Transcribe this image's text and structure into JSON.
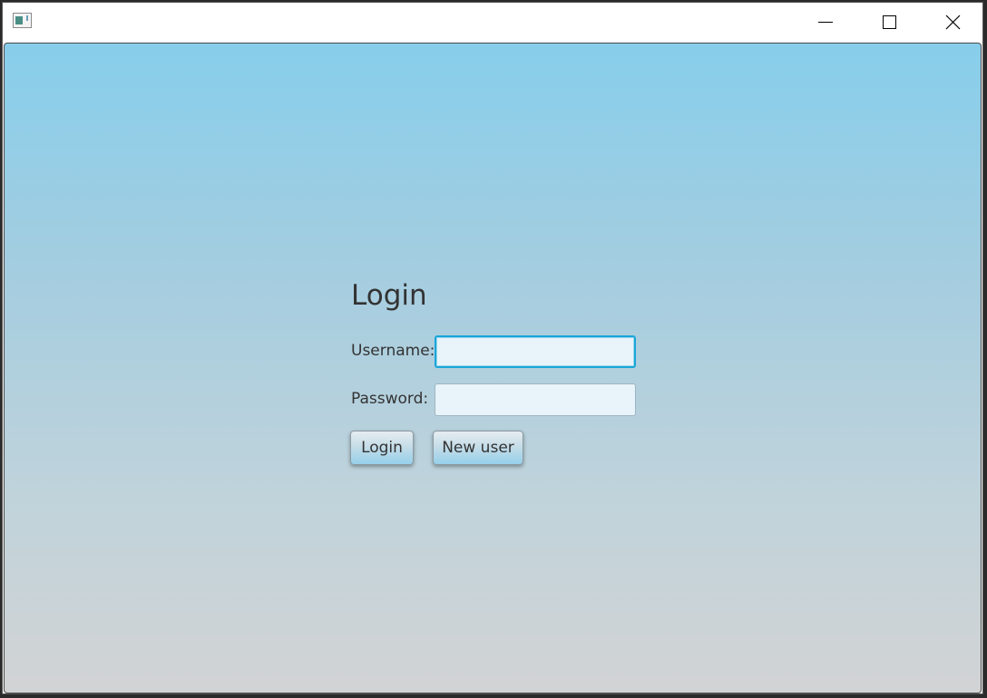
{
  "window": {
    "controls": {
      "minimize_icon": "minimize-icon",
      "maximize_icon": "maximize-icon",
      "close_icon": "close-icon"
    }
  },
  "form": {
    "title": "Login",
    "username": {
      "label": "Username:",
      "value": "",
      "focused": true
    },
    "password": {
      "label": "Password:",
      "value": ""
    },
    "buttons": {
      "login_label": "Login",
      "new_user_label": "New user"
    }
  },
  "colors": {
    "background_top": "#87ceeb",
    "background_bottom": "#d2d3d4",
    "focus_border": "#1aa6d9",
    "text": "#333333"
  }
}
